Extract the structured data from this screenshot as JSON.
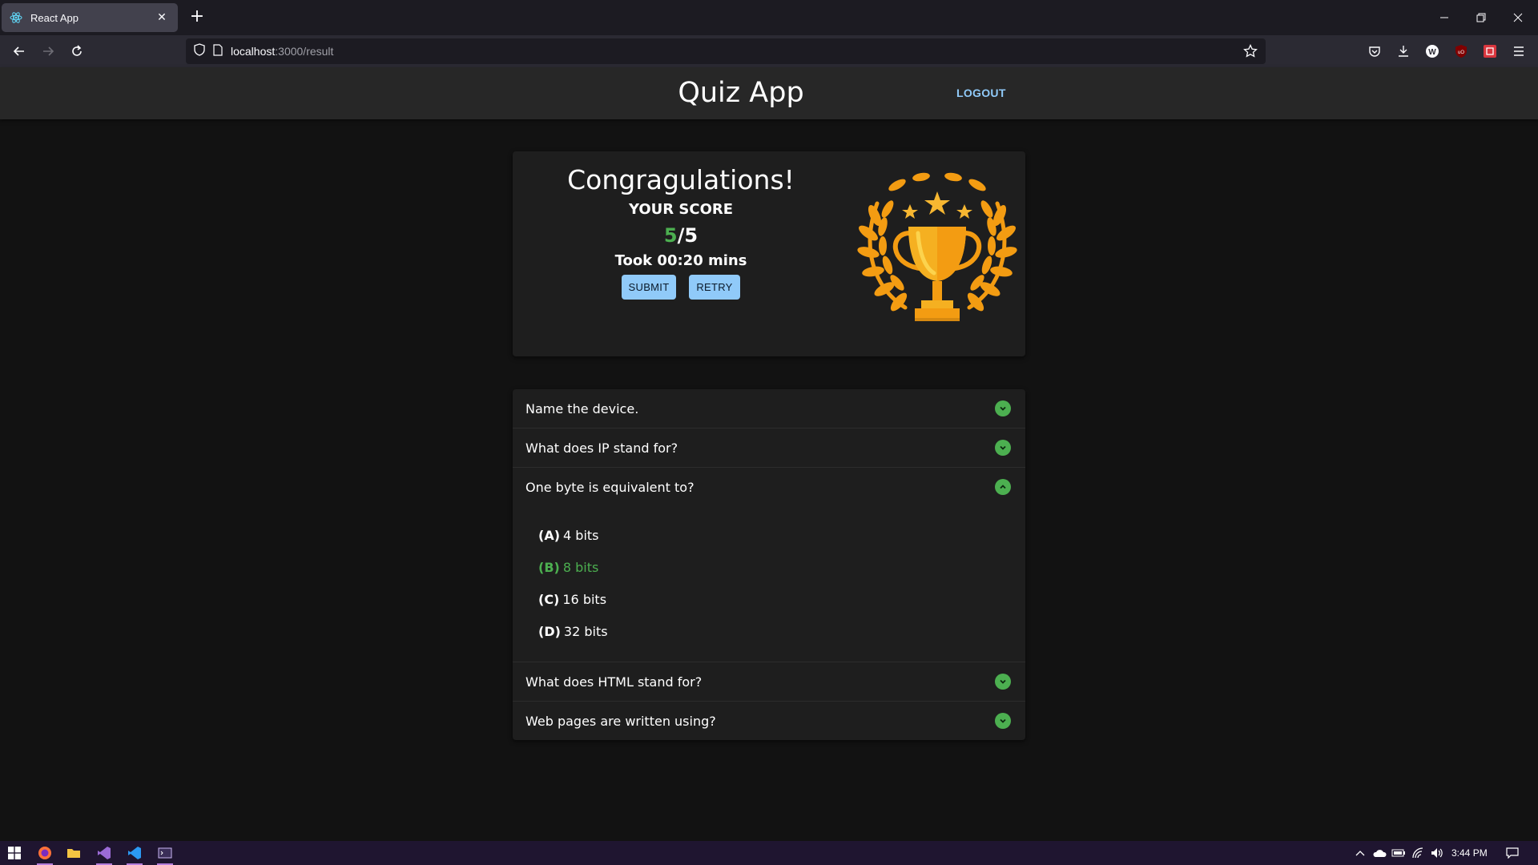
{
  "browser": {
    "tab_title": "React App",
    "url_host": "localhost",
    "url_path": ":3000/result"
  },
  "header": {
    "title": "Quiz App",
    "logout_label": "LOGOUT"
  },
  "result": {
    "heading": "Congragulations!",
    "score_label": "YOUR SCORE",
    "score_correct": "5",
    "score_total": "/5",
    "time_text": "Took 00:20 mins",
    "submit_label": "SUBMIT",
    "retry_label": "RETRY"
  },
  "questions": [
    {
      "text": "Name the device.",
      "expanded": false,
      "status": "correct"
    },
    {
      "text": "What does IP stand for?",
      "expanded": false,
      "status": "correct"
    },
    {
      "text": "One byte is equivalent to?",
      "expanded": true,
      "status": "correct",
      "options": [
        {
          "letter": "(A)",
          "text": "4 bits",
          "correct": false
        },
        {
          "letter": "(B)",
          "text": "8 bits",
          "correct": true
        },
        {
          "letter": "(C)",
          "text": "16 bits",
          "correct": false
        },
        {
          "letter": "(D)",
          "text": "32 bits",
          "correct": false
        }
      ]
    },
    {
      "text": "What does HTML stand for?",
      "expanded": false,
      "status": "correct"
    },
    {
      "text": "Web pages are written using?",
      "expanded": false,
      "status": "correct"
    }
  ],
  "taskbar": {
    "clock": "3:44 PM"
  },
  "colors": {
    "accent": "#90caf9",
    "correct": "#4caf50",
    "background": "#121212",
    "card": "#1e1e1e"
  }
}
